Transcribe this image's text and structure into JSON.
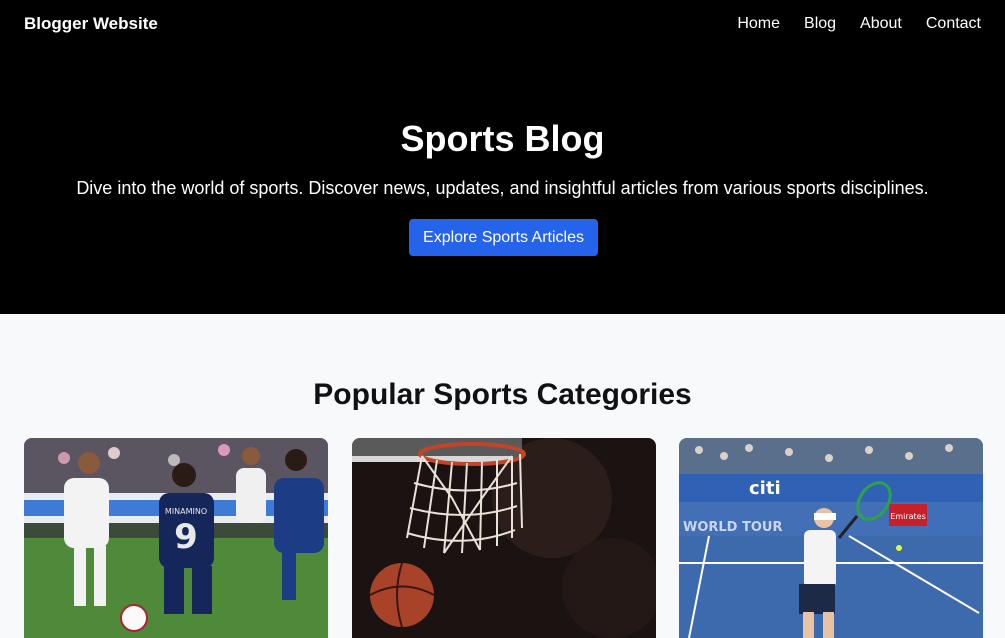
{
  "nav": {
    "brand": "Blogger Website",
    "links": [
      "Home",
      "Blog",
      "About",
      "Contact"
    ]
  },
  "hero": {
    "title": "Sports Blog",
    "subtitle": "Dive into the world of sports. Discover news, updates, and insightful articles from various sports disciplines.",
    "cta_label": "Explore Sports Articles"
  },
  "categories": {
    "title": "Popular Sports Categories",
    "cards": [
      {
        "image": "soccer-match-photo",
        "jersey_number": "9",
        "jersey_name": "MINAMINO"
      },
      {
        "image": "basketball-hoop-photo"
      },
      {
        "image": "tennis-player-photo",
        "banner_text": "WORLD TOUR",
        "sponsor": "citi",
        "sponsor2": "Emirates"
      }
    ]
  },
  "colors": {
    "nav_bg": "#000000",
    "accent": "#2563eb",
    "page_bg": "#f8f9fb"
  }
}
